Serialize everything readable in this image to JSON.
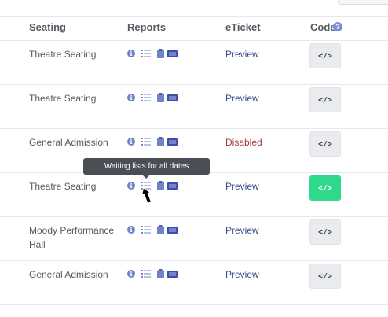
{
  "table": {
    "headers": {
      "seating": "Seating",
      "reports": "Reports",
      "eticket": "eTicket",
      "code": "Code"
    },
    "code_help_icon": "?",
    "rows": [
      {
        "seating": "Theatre Seating",
        "eticket": "Preview",
        "eticket_status": "preview",
        "code_label": "</>",
        "code_active": false
      },
      {
        "seating": "Theatre Seating",
        "eticket": "Preview",
        "eticket_status": "preview",
        "code_label": "</>",
        "code_active": false
      },
      {
        "seating": "General Admission",
        "eticket": "Disabled",
        "eticket_status": "disabled",
        "code_label": "</>",
        "code_active": false
      },
      {
        "seating": "Theatre Seating",
        "eticket": "Preview",
        "eticket_status": "preview",
        "code_label": "</>",
        "code_active": true
      },
      {
        "seating": "Moody Performance Hall",
        "eticket": "Preview",
        "eticket_status": "preview",
        "code_label": "</>",
        "code_active": false
      },
      {
        "seating": "General Admission",
        "eticket": "Preview",
        "eticket_status": "preview",
        "code_label": "</>",
        "code_active": false
      }
    ]
  },
  "tooltip": {
    "text": "Waiting lists for all dates"
  },
  "icons": {
    "info": "info-icon",
    "list": "waiting-list-icon",
    "clipboard": "clipboard-icon",
    "ticket": "ticket-icon",
    "code": "code-embed-icon",
    "cursor": "mouse-cursor-icon",
    "info_glyph": "i"
  },
  "colors": {
    "accent_blue": "#6f84c9",
    "preview_link": "#3b4a8c",
    "disabled_text": "#a33a3a",
    "code_active": "#2ed98c"
  }
}
